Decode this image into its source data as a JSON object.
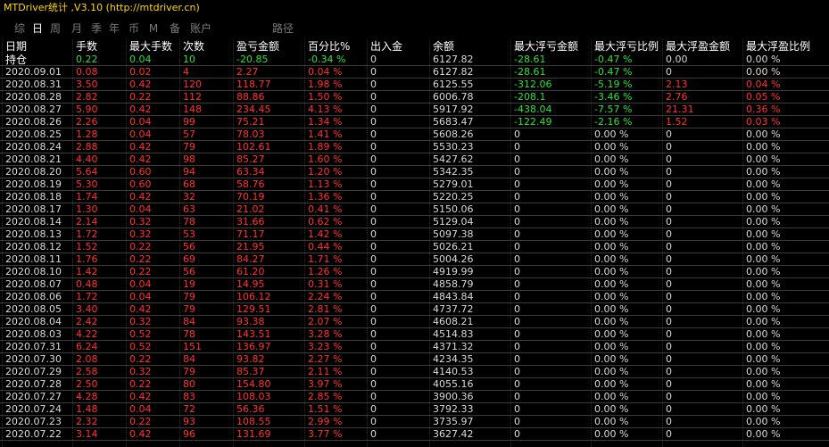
{
  "window": {
    "title": "MTDriver统计 ,V3.10 (http://mtdriver.cn)"
  },
  "tabs": [
    "综",
    "日",
    "周",
    "月",
    "季",
    "年",
    "币",
    "M",
    "备",
    "账户"
  ],
  "active_tab_index": 1,
  "path_label": "路径",
  "colors": {
    "positive": "#2be03a",
    "negative": "#ff3030",
    "neutral": "#d9d9d9",
    "title": "#ffd800"
  },
  "columns": [
    "日期",
    "手数",
    "最大手数",
    "次数",
    "盈亏金额",
    "百分比%",
    "出入金",
    "余额",
    "最大浮亏金额",
    "最大浮亏比例",
    "最大浮盈金额",
    "最大浮盈比例"
  ],
  "rows": [
    {
      "date": "持仓",
      "lots": "0.22",
      "max_lots": "0.04",
      "count": "10",
      "pnl": "-20.85",
      "pct": "-0.34 %",
      "io": "0",
      "balance": "6127.82",
      "max_dd": "-28.61",
      "max_dd_pct": "-0.47 %",
      "max_fp": "0.00",
      "max_fp_pct": "0.00 %",
      "tone": "pos"
    },
    {
      "date": "2020.09.01",
      "lots": "0.08",
      "max_lots": "0.02",
      "count": "4",
      "pnl": "2.27",
      "pct": "0.04 %",
      "io": "0",
      "balance": "6127.82",
      "max_dd": "-28.61",
      "max_dd_pct": "-0.47 %",
      "max_fp": "0",
      "max_fp_pct": "0.00 %",
      "tone": "neg"
    },
    {
      "date": "2020.08.31",
      "lots": "3.50",
      "max_lots": "0.42",
      "count": "120",
      "pnl": "118.77",
      "pct": "1.98 %",
      "io": "0",
      "balance": "6125.55",
      "max_dd": "-312.06",
      "max_dd_pct": "-5.19 %",
      "max_fp": "2.13",
      "max_fp_pct": "0.04 %",
      "tone": "neg"
    },
    {
      "date": "2020.08.28",
      "lots": "2.82",
      "max_lots": "0.22",
      "count": "112",
      "pnl": "88.86",
      "pct": "1.50 %",
      "io": "0",
      "balance": "6006.78",
      "max_dd": "-208.1",
      "max_dd_pct": "-3.46 %",
      "max_fp": "2.76",
      "max_fp_pct": "0.05 %",
      "tone": "neg"
    },
    {
      "date": "2020.08.27",
      "lots": "5.90",
      "max_lots": "0.42",
      "count": "148",
      "pnl": "234.45",
      "pct": "4.13 %",
      "io": "0",
      "balance": "5917.92",
      "max_dd": "-438.04",
      "max_dd_pct": "-7.57 %",
      "max_fp": "21.31",
      "max_fp_pct": "0.36 %",
      "tone": "neg"
    },
    {
      "date": "2020.08.26",
      "lots": "2.26",
      "max_lots": "0.04",
      "count": "99",
      "pnl": "75.21",
      "pct": "1.34 %",
      "io": "0",
      "balance": "5683.47",
      "max_dd": "-122.49",
      "max_dd_pct": "-2.16 %",
      "max_fp": "1.52",
      "max_fp_pct": "0.03 %",
      "tone": "neg"
    },
    {
      "date": "2020.08.25",
      "lots": "1.28",
      "max_lots": "0.04",
      "count": "57",
      "pnl": "78.03",
      "pct": "1.41 %",
      "io": "0",
      "balance": "5608.26",
      "max_dd": "0",
      "max_dd_pct": "0.00 %",
      "max_fp": "0",
      "max_fp_pct": "0.00 %",
      "tone": "neg"
    },
    {
      "date": "2020.08.24",
      "lots": "2.88",
      "max_lots": "0.42",
      "count": "79",
      "pnl": "102.61",
      "pct": "1.89 %",
      "io": "0",
      "balance": "5530.23",
      "max_dd": "0",
      "max_dd_pct": "0.00 %",
      "max_fp": "0",
      "max_fp_pct": "0.00 %",
      "tone": "neg"
    },
    {
      "date": "2020.08.21",
      "lots": "4.40",
      "max_lots": "0.42",
      "count": "98",
      "pnl": "85.27",
      "pct": "1.60 %",
      "io": "0",
      "balance": "5427.62",
      "max_dd": "0",
      "max_dd_pct": "0.00 %",
      "max_fp": "0",
      "max_fp_pct": "0.00 %",
      "tone": "neg"
    },
    {
      "date": "2020.08.20",
      "lots": "5.64",
      "max_lots": "0.60",
      "count": "94",
      "pnl": "63.34",
      "pct": "1.20 %",
      "io": "0",
      "balance": "5342.35",
      "max_dd": "0",
      "max_dd_pct": "0.00 %",
      "max_fp": "0",
      "max_fp_pct": "0.00 %",
      "tone": "neg"
    },
    {
      "date": "2020.08.19",
      "lots": "5.30",
      "max_lots": "0.60",
      "count": "68",
      "pnl": "58.76",
      "pct": "1.13 %",
      "io": "0",
      "balance": "5279.01",
      "max_dd": "0",
      "max_dd_pct": "0.00 %",
      "max_fp": "0",
      "max_fp_pct": "0.00 %",
      "tone": "neg"
    },
    {
      "date": "2020.08.18",
      "lots": "1.74",
      "max_lots": "0.42",
      "count": "32",
      "pnl": "70.19",
      "pct": "1.36 %",
      "io": "0",
      "balance": "5220.25",
      "max_dd": "0",
      "max_dd_pct": "0.00 %",
      "max_fp": "0",
      "max_fp_pct": "0.00 %",
      "tone": "neg"
    },
    {
      "date": "2020.08.17",
      "lots": "1.30",
      "max_lots": "0.04",
      "count": "63",
      "pnl": "21.02",
      "pct": "0.41 %",
      "io": "0",
      "balance": "5150.06",
      "max_dd": "0",
      "max_dd_pct": "0.00 %",
      "max_fp": "0",
      "max_fp_pct": "0.00 %",
      "tone": "neg"
    },
    {
      "date": "2020.08.14",
      "lots": "2.14",
      "max_lots": "0.32",
      "count": "78",
      "pnl": "31.66",
      "pct": "0.62 %",
      "io": "0",
      "balance": "5129.04",
      "max_dd": "0",
      "max_dd_pct": "0.00 %",
      "max_fp": "0",
      "max_fp_pct": "0.00 %",
      "tone": "neg"
    },
    {
      "date": "2020.08.13",
      "lots": "1.72",
      "max_lots": "0.32",
      "count": "53",
      "pnl": "71.17",
      "pct": "1.42 %",
      "io": "0",
      "balance": "5097.38",
      "max_dd": "0",
      "max_dd_pct": "0.00 %",
      "max_fp": "0",
      "max_fp_pct": "0.00 %",
      "tone": "neg"
    },
    {
      "date": "2020.08.12",
      "lots": "1.52",
      "max_lots": "0.22",
      "count": "56",
      "pnl": "21.95",
      "pct": "0.44 %",
      "io": "0",
      "balance": "5026.21",
      "max_dd": "0",
      "max_dd_pct": "0.00 %",
      "max_fp": "0",
      "max_fp_pct": "0.00 %",
      "tone": "neg"
    },
    {
      "date": "2020.08.11",
      "lots": "1.76",
      "max_lots": "0.22",
      "count": "69",
      "pnl": "84.27",
      "pct": "1.71 %",
      "io": "0",
      "balance": "5004.26",
      "max_dd": "0",
      "max_dd_pct": "0.00 %",
      "max_fp": "0",
      "max_fp_pct": "0.00 %",
      "tone": "neg"
    },
    {
      "date": "2020.08.10",
      "lots": "1.42",
      "max_lots": "0.22",
      "count": "56",
      "pnl": "61.20",
      "pct": "1.26 %",
      "io": "0",
      "balance": "4919.99",
      "max_dd": "0",
      "max_dd_pct": "0.00 %",
      "max_fp": "0",
      "max_fp_pct": "0.00 %",
      "tone": "neg"
    },
    {
      "date": "2020.08.07",
      "lots": "0.48",
      "max_lots": "0.04",
      "count": "19",
      "pnl": "14.95",
      "pct": "0.31 %",
      "io": "0",
      "balance": "4858.79",
      "max_dd": "0",
      "max_dd_pct": "0.00 %",
      "max_fp": "0",
      "max_fp_pct": "0.00 %",
      "tone": "neg"
    },
    {
      "date": "2020.08.06",
      "lots": "1.72",
      "max_lots": "0.04",
      "count": "79",
      "pnl": "106.12",
      "pct": "2.24 %",
      "io": "0",
      "balance": "4843.84",
      "max_dd": "0",
      "max_dd_pct": "0.00 %",
      "max_fp": "0",
      "max_fp_pct": "0.00 %",
      "tone": "neg"
    },
    {
      "date": "2020.08.05",
      "lots": "3.40",
      "max_lots": "0.42",
      "count": "79",
      "pnl": "129.51",
      "pct": "2.81 %",
      "io": "0",
      "balance": "4737.72",
      "max_dd": "0",
      "max_dd_pct": "0.00 %",
      "max_fp": "0",
      "max_fp_pct": "0.00 %",
      "tone": "neg"
    },
    {
      "date": "2020.08.04",
      "lots": "2.42",
      "max_lots": "0.32",
      "count": "84",
      "pnl": "93.38",
      "pct": "2.07 %",
      "io": "0",
      "balance": "4608.21",
      "max_dd": "0",
      "max_dd_pct": "0.00 %",
      "max_fp": "0",
      "max_fp_pct": "0.00 %",
      "tone": "neg"
    },
    {
      "date": "2020.08.03",
      "lots": "4.22",
      "max_lots": "0.52",
      "count": "78",
      "pnl": "143.51",
      "pct": "3.28 %",
      "io": "0",
      "balance": "4514.83",
      "max_dd": "0",
      "max_dd_pct": "0.00 %",
      "max_fp": "0",
      "max_fp_pct": "0.00 %",
      "tone": "neg"
    },
    {
      "date": "2020.07.31",
      "lots": "6.24",
      "max_lots": "0.52",
      "count": "151",
      "pnl": "136.97",
      "pct": "3.23 %",
      "io": "0",
      "balance": "4371.32",
      "max_dd": "0",
      "max_dd_pct": "0.00 %",
      "max_fp": "0",
      "max_fp_pct": "0.00 %",
      "tone": "neg"
    },
    {
      "date": "2020.07.30",
      "lots": "2.08",
      "max_lots": "0.22",
      "count": "84",
      "pnl": "93.82",
      "pct": "2.27 %",
      "io": "0",
      "balance": "4234.35",
      "max_dd": "0",
      "max_dd_pct": "0.00 %",
      "max_fp": "0",
      "max_fp_pct": "0.00 %",
      "tone": "neg"
    },
    {
      "date": "2020.07.29",
      "lots": "2.58",
      "max_lots": "0.32",
      "count": "79",
      "pnl": "85.37",
      "pct": "2.11 %",
      "io": "0",
      "balance": "4140.53",
      "max_dd": "0",
      "max_dd_pct": "0.00 %",
      "max_fp": "0",
      "max_fp_pct": "0.00 %",
      "tone": "neg"
    },
    {
      "date": "2020.07.28",
      "lots": "2.50",
      "max_lots": "0.22",
      "count": "80",
      "pnl": "154.80",
      "pct": "3.97 %",
      "io": "0",
      "balance": "4055.16",
      "max_dd": "0",
      "max_dd_pct": "0.00 %",
      "max_fp": "0",
      "max_fp_pct": "0.00 %",
      "tone": "neg"
    },
    {
      "date": "2020.07.27",
      "lots": "4.28",
      "max_lots": "0.42",
      "count": "83",
      "pnl": "108.03",
      "pct": "2.85 %",
      "io": "0",
      "balance": "3900.36",
      "max_dd": "0",
      "max_dd_pct": "0.00 %",
      "max_fp": "0",
      "max_fp_pct": "0.00 %",
      "tone": "neg"
    },
    {
      "date": "2020.07.24",
      "lots": "1.48",
      "max_lots": "0.04",
      "count": "72",
      "pnl": "56.36",
      "pct": "1.51 %",
      "io": "0",
      "balance": "3792.33",
      "max_dd": "0",
      "max_dd_pct": "0.00 %",
      "max_fp": "0",
      "max_fp_pct": "0.00 %",
      "tone": "neg"
    },
    {
      "date": "2020.07.23",
      "lots": "2.32",
      "max_lots": "0.22",
      "count": "93",
      "pnl": "108.55",
      "pct": "2.99 %",
      "io": "0",
      "balance": "3735.97",
      "max_dd": "0",
      "max_dd_pct": "0.00 %",
      "max_fp": "0",
      "max_fp_pct": "0.00 %",
      "tone": "neg"
    },
    {
      "date": "2020.07.22",
      "lots": "3.14",
      "max_lots": "0.42",
      "count": "96",
      "pnl": "131.69",
      "pct": "3.77 %",
      "io": "0",
      "balance": "3627.42",
      "max_dd": "0",
      "max_dd_pct": "0.00 %",
      "max_fp": "0",
      "max_fp_pct": "0.00 %",
      "tone": "neg"
    }
  ]
}
